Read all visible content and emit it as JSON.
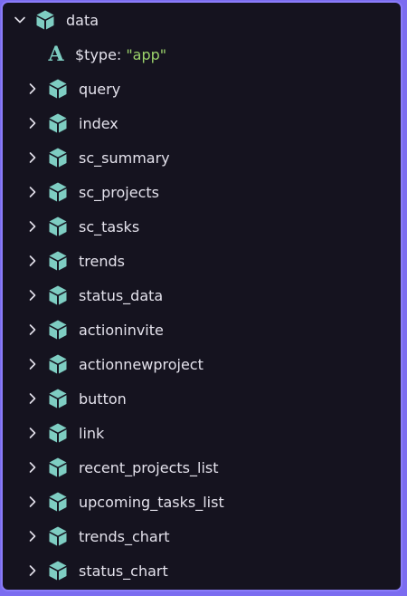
{
  "tree": {
    "root": {
      "label": "data",
      "expanded": true,
      "icon": "cube-icon"
    },
    "type_row": {
      "key": "$type:",
      "value": "\"app\"",
      "icon": "type-a-icon"
    },
    "children": [
      {
        "label": "query"
      },
      {
        "label": "index"
      },
      {
        "label": "sc_summary"
      },
      {
        "label": "sc_projects"
      },
      {
        "label": "sc_tasks"
      },
      {
        "label": "trends"
      },
      {
        "label": "status_data"
      },
      {
        "label": "actioninvite"
      },
      {
        "label": "actionnewproject"
      },
      {
        "label": "button"
      },
      {
        "label": "link"
      },
      {
        "label": "recent_projects_list"
      },
      {
        "label": "upcoming_tasks_list"
      },
      {
        "label": "trends_chart"
      },
      {
        "label": "status_chart"
      }
    ]
  },
  "colors": {
    "background": "#15131f",
    "border": "#8a7cf8",
    "icon": "#7ecdc2",
    "text": "#e4e2ec",
    "string": "#9bd26b"
  }
}
